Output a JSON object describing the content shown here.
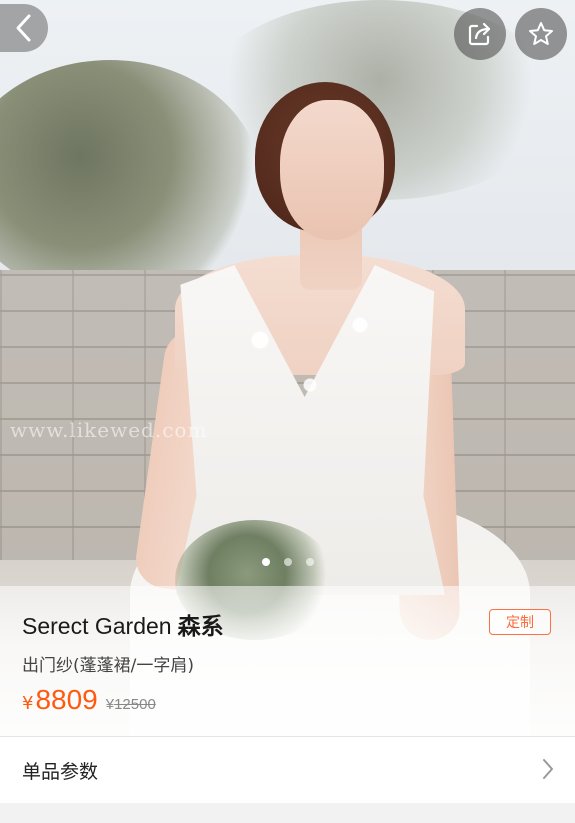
{
  "product": {
    "title_en": "Serect Garden",
    "title_cn": "森系",
    "subtitle": "出门纱(蓬蓬裙/一字肩)",
    "currency": "¥",
    "price": "8809",
    "original_currency": "¥",
    "original_price": "12500",
    "badge": "定制"
  },
  "hero": {
    "watermark": "www.likewed.com",
    "carousel_count": 3,
    "carousel_active_index": 0
  },
  "nav": {
    "back_icon": "chevron-left-icon",
    "share_icon": "share-icon",
    "favorite_icon": "star-icon"
  },
  "specs": {
    "label": "单品参数",
    "icon": "chevron-right-icon"
  },
  "colors": {
    "price": "#ff5a10",
    "badge_border": "#ff7043",
    "page_bg": "#f2f2f2"
  }
}
